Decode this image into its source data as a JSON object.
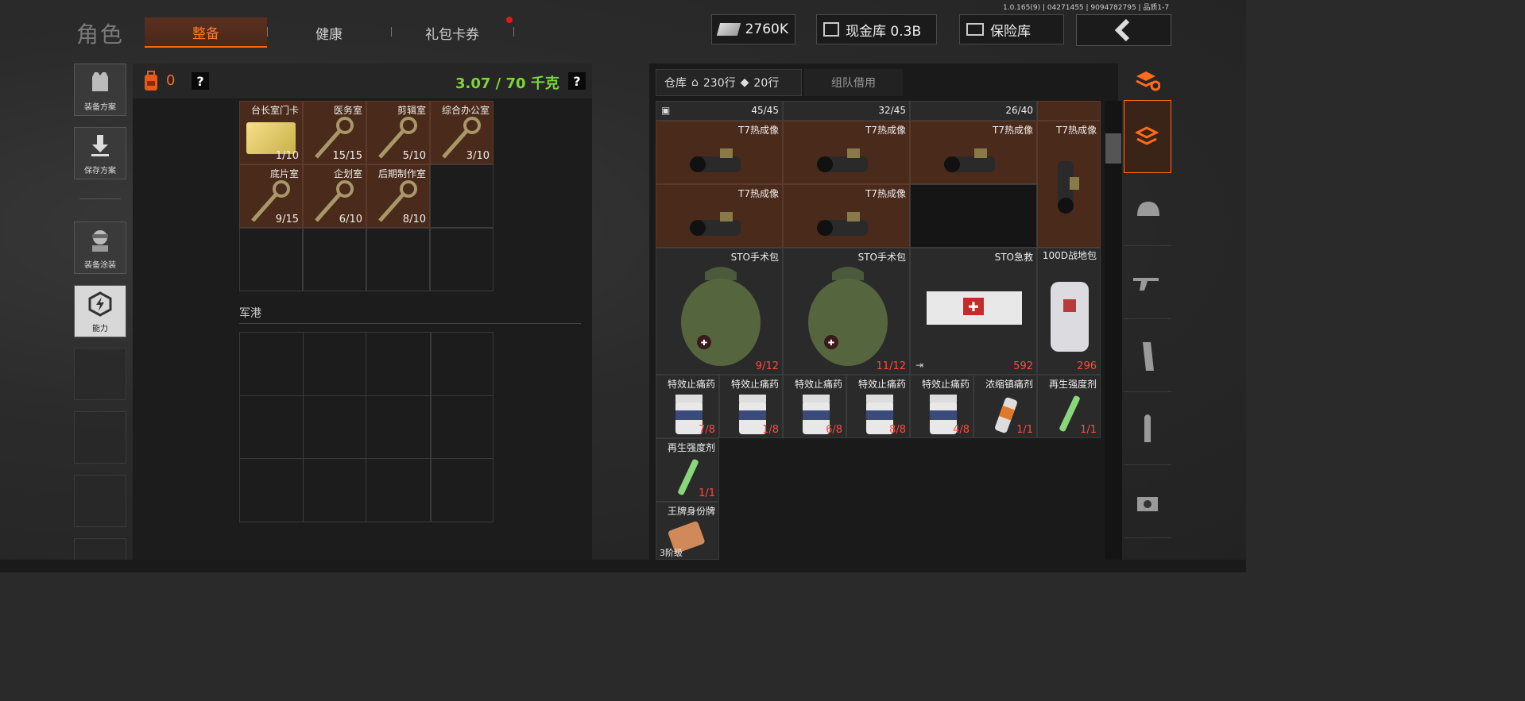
{
  "version": "1.0.165(9) | 04271455 | 9094782795 | 品质1-7",
  "header": {
    "title": "角色",
    "tabs": [
      {
        "label": "整备",
        "active": true
      },
      {
        "label": "健康",
        "active": false
      },
      {
        "label": "礼包卡券",
        "active": false
      }
    ],
    "currency": {
      "cash": "2760K",
      "cash_vault": "现金库 0.3B",
      "safe": "保险库"
    }
  },
  "sidebar": {
    "items": [
      {
        "label": "装备方案",
        "icon": "vest-icon"
      },
      {
        "label": "保存方案",
        "icon": "download-icon"
      },
      {
        "label": "装备涂装",
        "icon": "soldier-icon"
      },
      {
        "label": "能力",
        "icon": "ability-icon"
      }
    ]
  },
  "loadout": {
    "backpack_count": "0",
    "weight": "3.07 / 70 千克",
    "help": "?",
    "section_label": "军港",
    "keys": [
      {
        "name": "台长室门卡",
        "count": "1/10"
      },
      {
        "name": "医务室",
        "count": "15/15"
      },
      {
        "name": "剪辑室",
        "count": "5/10"
      },
      {
        "name": "综合办公室",
        "count": "3/10"
      },
      {
        "name": "底片室",
        "count": "9/15"
      },
      {
        "name": "企划室",
        "count": "6/10"
      },
      {
        "name": "后期制作室",
        "count": "8/10"
      }
    ]
  },
  "warehouse": {
    "title": "仓库",
    "rows_home": "230行",
    "rows_ticket": "20行",
    "team_borrow": "组队借用",
    "top_counts": [
      "45/45",
      "32/45",
      "26/40"
    ],
    "thermal": [
      {
        "name": "T7热成像"
      },
      {
        "name": "T7热成像"
      },
      {
        "name": "T7热成像"
      },
      {
        "name": "T7热成像"
      },
      {
        "name": "T7热成像"
      },
      {
        "name": "T7热成像"
      }
    ],
    "medkits": [
      {
        "name": "STO手术包",
        "count": "9/12"
      },
      {
        "name": "STO手术包",
        "count": "11/12"
      },
      {
        "name": "STO急救",
        "count": "592"
      },
      {
        "name": "100D战地包",
        "count": "296"
      }
    ],
    "pills": [
      {
        "name": "特效止痛药",
        "count": "7/8"
      },
      {
        "name": "特效止痛药",
        "count": "1/8"
      },
      {
        "name": "特效止痛药",
        "count": "6/8"
      },
      {
        "name": "特效止痛药",
        "count": "8/8"
      },
      {
        "name": "特效止痛药",
        "count": "4/8"
      },
      {
        "name": "浓缩镇痛剂",
        "count": "1/1"
      },
      {
        "name": "再生强度剂",
        "count": "1/1"
      }
    ],
    "regen": {
      "name": "再生强度剂",
      "count": "1/1"
    },
    "dogtag": {
      "name": "王牌身份牌",
      "count": "3阶级"
    }
  },
  "colors": {
    "accent": "#ff6a1a",
    "weight_green": "#7cd63a",
    "count_red": "#ff4a3a",
    "item_bg": "#4a2a1a"
  }
}
